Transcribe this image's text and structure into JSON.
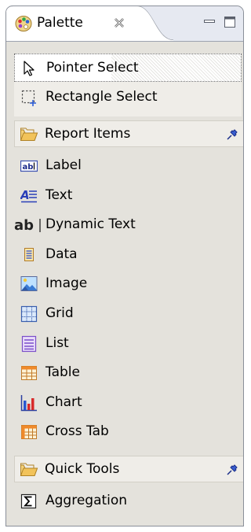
{
  "palette": {
    "title": "Palette",
    "tools": [
      {
        "label": "Pointer Select",
        "icon": "pointer-icon"
      },
      {
        "label": "Rectangle Select",
        "icon": "rectangle-select-icon"
      }
    ],
    "drawers": [
      {
        "label": "Report Items",
        "icon": "folder-icon",
        "items": [
          {
            "label": "Label",
            "icon": "label-icon"
          },
          {
            "label": "Text",
            "icon": "text-icon"
          },
          {
            "label": "Dynamic Text",
            "icon": "dynamic-text-icon"
          },
          {
            "label": "Data",
            "icon": "data-icon"
          },
          {
            "label": "Image",
            "icon": "image-icon"
          },
          {
            "label": "Grid",
            "icon": "grid-icon"
          },
          {
            "label": "List",
            "icon": "list-icon"
          },
          {
            "label": "Table",
            "icon": "table-icon"
          },
          {
            "label": "Chart",
            "icon": "chart-icon"
          },
          {
            "label": "Cross Tab",
            "icon": "cross-tab-icon"
          }
        ]
      },
      {
        "label": "Quick Tools",
        "icon": "folder-icon",
        "items": [
          {
            "label": "Aggregation",
            "icon": "aggregation-icon"
          }
        ]
      }
    ],
    "colors": {
      "accent": "#3a5fd0",
      "folder": "#f2c35a",
      "panel": "#e4e2dc"
    }
  }
}
